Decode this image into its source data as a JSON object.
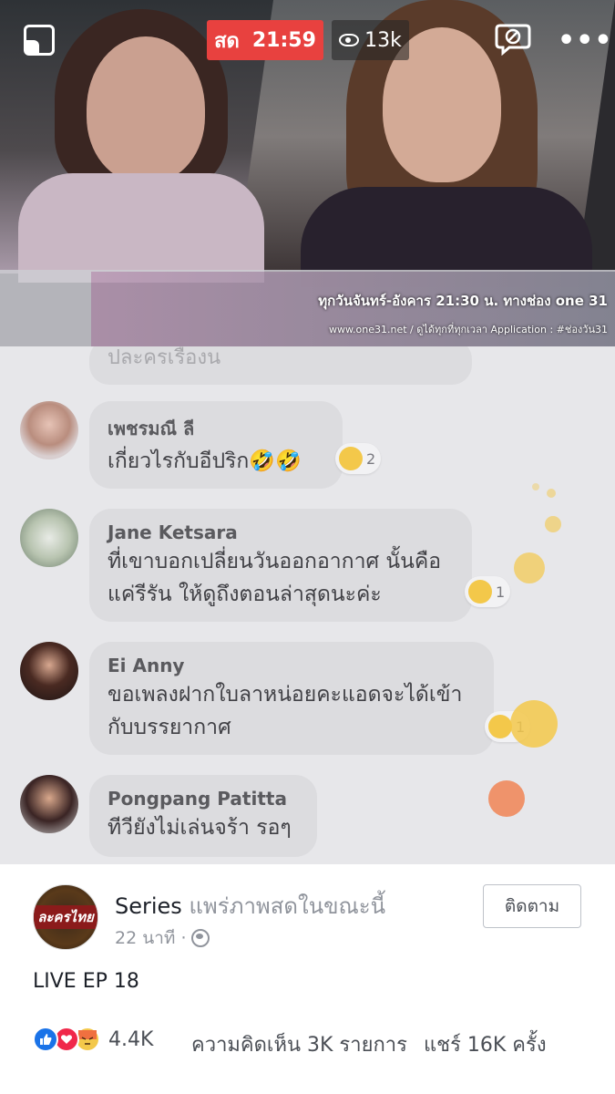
{
  "video": {
    "live_label": "สด",
    "timer": "21:59",
    "viewers": "13k",
    "caption_line1": "ทุกวันจันทร์-อังคาร 21:30 น. ทางช่อง one 31",
    "caption_line2": "www.one31.net / ดูได้ทุกที่ทุกเวลา Application : #ช่องวัน31"
  },
  "comments": {
    "faded_text": "ปละครเรื่องน",
    "items": [
      {
        "name": "เพชรมณี ลี",
        "lines": [
          "เกี่ยวไรกับอีปริก🤣🤣"
        ],
        "reaction_count": "2",
        "reaction_icon": "laughing-emoji"
      },
      {
        "name": "Jane Ketsara",
        "lines": [
          "ที่เขาบอกเปลี่ยนวันออกอากาศ นั้นคือ",
          "แค่รีรัน ให้ดูถึงตอนล่าสุดนะค่ะ"
        ],
        "reaction_count": "1",
        "reaction_icon": "laughing-emoji"
      },
      {
        "name": "Ei Anny",
        "lines": [
          "ขอเพลงฝากใบลาหน่อยคะแอดจะได้เข้า",
          "กับบรรยากาศ"
        ],
        "reaction_count": "1",
        "reaction_icon": "wow-emoji"
      },
      {
        "name": "Pongpang Patitta",
        "lines": [
          "ทีวียังไม่เล่นจร้า รอๆ"
        ],
        "reaction_count": "",
        "reaction_icon": ""
      }
    ]
  },
  "post": {
    "page_name": "Series",
    "status": "แพร่ภาพสดในขณะนี้",
    "time": "22 นาที ·",
    "follow_label": "ติดตาม",
    "title": "LIVE EP 18",
    "avatar_text": "ละครไทย",
    "reactions_count": "4.4K",
    "comments_count": "ความคิดเห็น 3K รายการ",
    "shares_count": "แชร์ 16K ครั้ง"
  },
  "colors": {
    "live_red": "#e8413f",
    "like_blue": "#1a73e8",
    "love_red": "#f0284a",
    "emoji_yellow": "#f3c84a"
  }
}
